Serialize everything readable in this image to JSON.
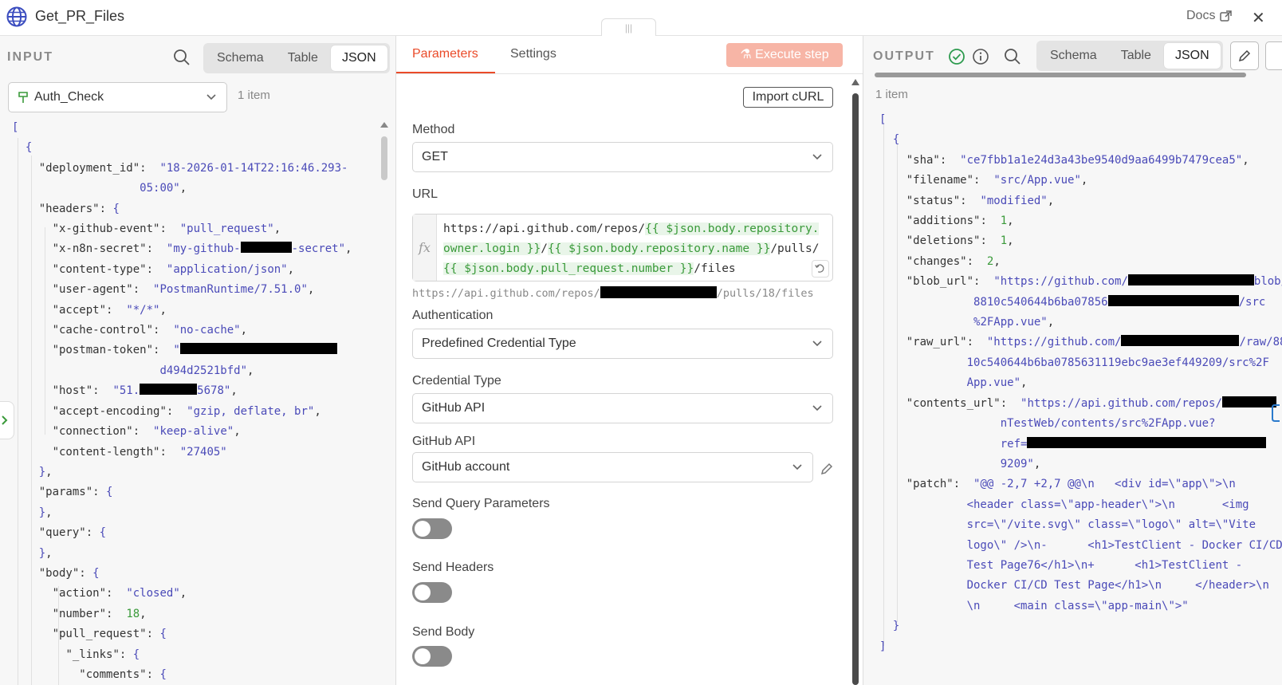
{
  "header": {
    "title": "Get_PR_Files",
    "docs_label": "Docs",
    "close_glyph": "✕",
    "handle_glyph": "|||"
  },
  "input": {
    "section_label": "INPUT",
    "view_tabs": [
      "Schema",
      "Table",
      "JSON"
    ],
    "active_view": "JSON",
    "node_name": "Auth_Check",
    "item_count": "1 item"
  },
  "params": {
    "tabs": [
      "Parameters",
      "Settings"
    ],
    "active_tab": "Parameters",
    "execute_label": "Execute step",
    "import_curl_label": "Import cURL",
    "method_label": "Method",
    "method_value": "GET",
    "url_label": "URL",
    "url_line1_plain": "https://api.github.com/repos/",
    "url_line1_expr": "{{ $json.body.repository.",
    "url_line2_expr_a": "owner.login }}",
    "url_line2_slash": "/",
    "url_line2_expr_b": "{{ $json.body.repository.name }}",
    "url_line2_plain": "/pulls/",
    "url_line3_expr": "{{ $json.body.pull_request.number }}",
    "url_line3_plain": "/files",
    "url_preview_start": "https://api.github.com/repos/",
    "url_preview_end": "/pulls/18/files",
    "auth_label": "Authentication",
    "auth_value": "Predefined Credential Type",
    "cred_type_label": "Credential Type",
    "cred_type_value": "GitHub API",
    "github_api_label": "GitHub API",
    "github_api_value": "GitHub account",
    "send_query_label": "Send Query Parameters",
    "send_headers_label": "Send Headers",
    "send_body_label": "Send Body"
  },
  "output": {
    "section_label": "OUTPUT",
    "view_tabs": [
      "Schema",
      "Table",
      "JSON"
    ],
    "active_view": "JSON",
    "item_count": "1 item"
  },
  "colors": {
    "accent": "#ea4b29",
    "string": "#4a4ab8",
    "number": "#3a9a3a",
    "success": "#2e9b4f"
  }
}
